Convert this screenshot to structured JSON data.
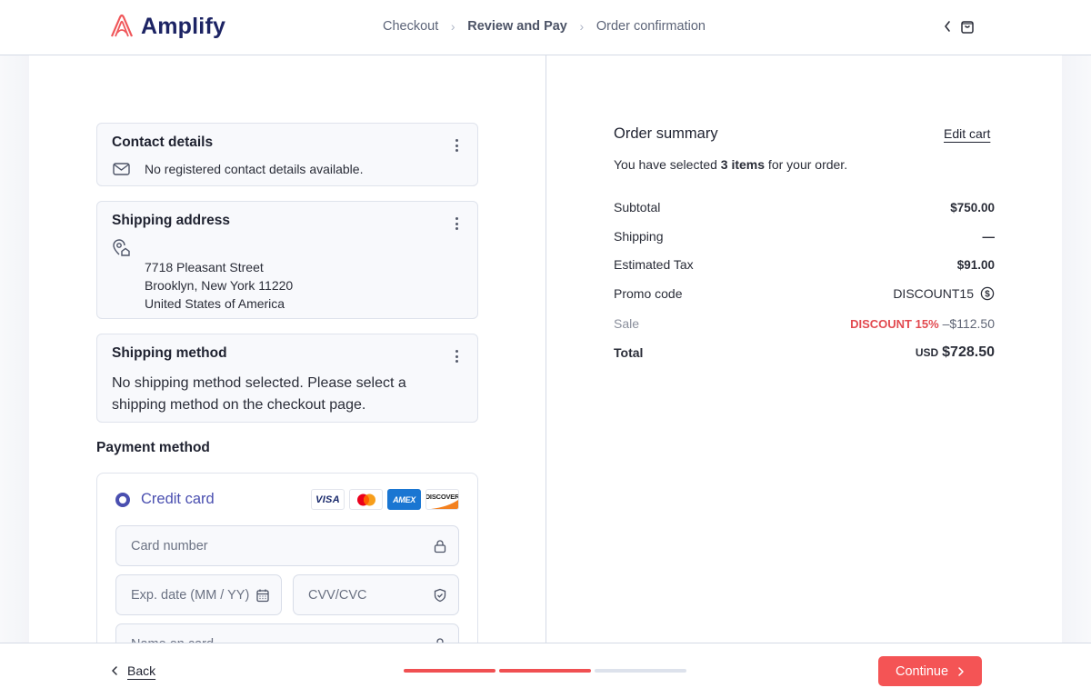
{
  "header": {
    "brand": "Amplify",
    "breadcrumb": [
      {
        "label": "Checkout",
        "active": false
      },
      {
        "label": "Review and Pay",
        "active": true
      },
      {
        "label": "Order confirmation",
        "active": false
      }
    ],
    "icons": [
      "chevron-left-icon",
      "shopping-bag-icon"
    ]
  },
  "left": {
    "contact": {
      "title": "Contact details",
      "text": "No registered contact details available."
    },
    "shipping_address": {
      "title": "Shipping address",
      "lines": [
        "7718 Pleasant Street",
        "Brooklyn, New York 11220",
        "United States of America"
      ]
    },
    "shipping_method": {
      "title": "Shipping method",
      "text_line1": "No shipping method selected. Please select a",
      "text_line2": "shipping method on the checkout page."
    },
    "payment": {
      "section_title": "Payment method",
      "option_label": "Credit card",
      "brands": [
        "VISA",
        "Mastercard",
        "AMEX",
        "DISCOVER"
      ],
      "fields": {
        "card_number": "Card number",
        "exp_date": "Exp. date (MM / YY)",
        "cvv": "CVV/CVC",
        "name_on_card": "Name on card"
      }
    }
  },
  "summary": {
    "title": "Order summary",
    "edit_cart": "Edit cart",
    "selected_prefix": "You have selected ",
    "selected_count": "3 items",
    "selected_suffix": " for your order.",
    "rows": {
      "subtotal": {
        "label": "Subtotal",
        "value": "$750.00"
      },
      "shipping": {
        "label": "Shipping",
        "value": "—"
      },
      "tax": {
        "label": "Estimated Tax",
        "value": "$91.00"
      },
      "promo": {
        "label": "Promo code",
        "value": "DISCOUNT15"
      },
      "sale": {
        "label": "Sale",
        "badge": "DISCOUNT 15%",
        "value": "–$112.50"
      },
      "total": {
        "label": "Total",
        "currency": "USD",
        "value": "$728.50"
      }
    }
  },
  "footer": {
    "back": "Back",
    "continue": "Continue",
    "progress": {
      "completed_steps": 2,
      "total_steps": 3
    },
    "accent": "#f45455"
  }
}
